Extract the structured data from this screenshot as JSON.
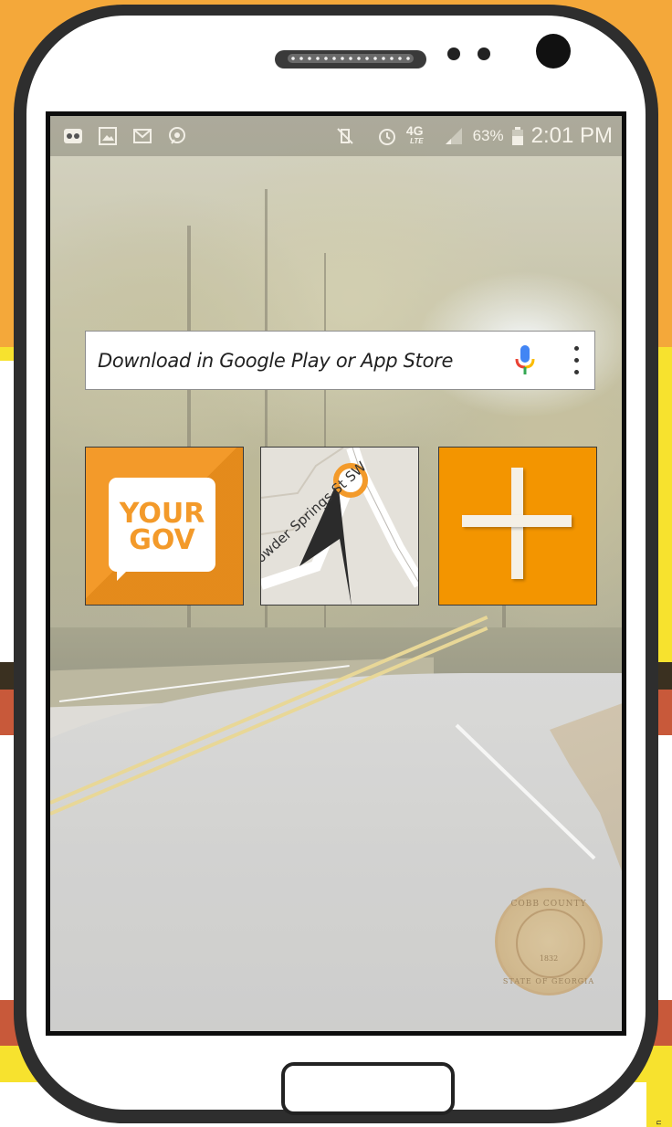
{
  "status_bar": {
    "notification_icons": [
      "voicemail-icon",
      "gallery-icon",
      "gmail-icon",
      "messenger-icon"
    ],
    "network_label": "4G",
    "network_sublabel": "LTE",
    "battery_percent": "63%",
    "time": "2:01 PM"
  },
  "search_widget": {
    "text": "Download in Google Play or App Store",
    "mic_colors": [
      "#4285F4",
      "#EA4335",
      "#FBBC05",
      "#34A853"
    ]
  },
  "apps": [
    {
      "id": "yourgov",
      "line1": "YOUR",
      "line2": "GOV",
      "color": "#F39A2A"
    },
    {
      "id": "map",
      "street": "Powder Springs St SW"
    },
    {
      "id": "add",
      "color": "#F39500"
    }
  ],
  "seal": {
    "top": "COBB COUNTY",
    "year": "1832",
    "bottom": "STATE OF GEORGIA"
  },
  "corner_tag": "n"
}
